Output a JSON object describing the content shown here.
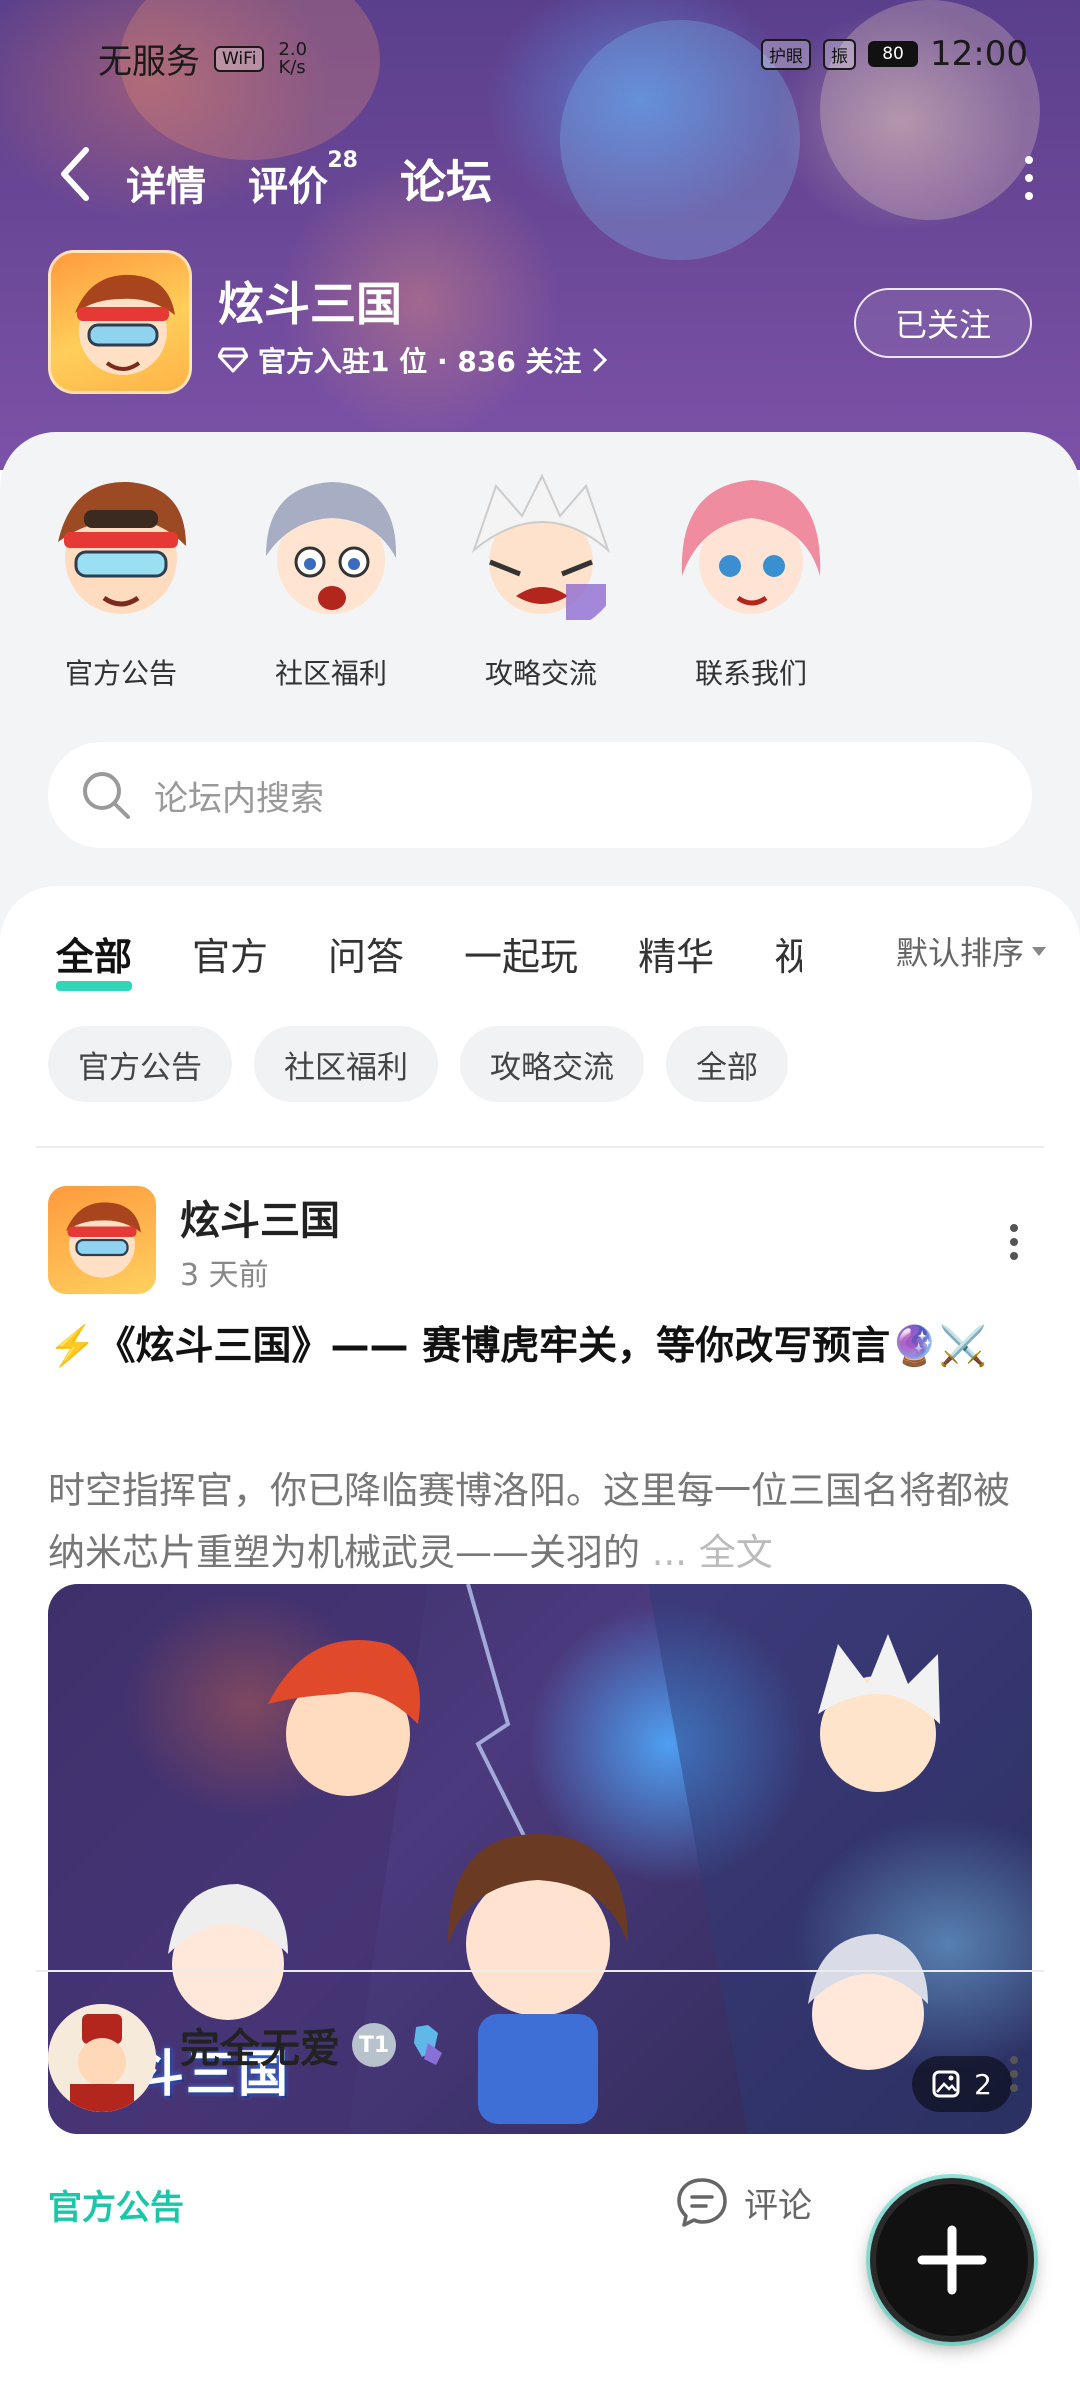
{
  "status_bar": {
    "carrier": "无服务",
    "wifi": "WiFi",
    "net_speed": "2.0 K/s",
    "eye_care": "护眼",
    "vibrate": "振",
    "battery": "80",
    "time": "12:00"
  },
  "nav": {
    "tabs": [
      {
        "label": "详情"
      },
      {
        "label": "评价",
        "badge": "28"
      },
      {
        "label": "论坛",
        "active": true
      }
    ]
  },
  "game": {
    "name": "炫斗三国",
    "meta": "官方入驻1 位 · 836 关注",
    "follow_label": "已关注"
  },
  "shortcuts": [
    {
      "label": "官方公告"
    },
    {
      "label": "社区福利"
    },
    {
      "label": "攻略交流"
    },
    {
      "label": "联系我们"
    }
  ],
  "search": {
    "placeholder": "论坛内搜索"
  },
  "feed_tabs": [
    {
      "label": "全部",
      "active": true
    },
    {
      "label": "官方"
    },
    {
      "label": "问答"
    },
    {
      "label": "一起玩"
    },
    {
      "label": "精华"
    },
    {
      "label": "视频"
    }
  ],
  "sort_label": "默认排序",
  "chips": [
    "官方公告",
    "社区福利",
    "攻略交流",
    "全部"
  ],
  "post": {
    "author": "炫斗三国",
    "time": "3 天前",
    "title": "⚡️《炫斗三国》—— 赛博虎牢关，等你改写预言🔮⚔️",
    "body": "时空指挥官，你已降临赛博洛阳。这里每一位三国名将都被纳米芯片重塑为机械武灵——关羽的",
    "ellipsis": " ... ",
    "full_text_label": "全文",
    "image_logo": "炫斗三国",
    "image_count": "2",
    "category": "官方公告",
    "comment_label": "评论"
  },
  "post2": {
    "author": "完全无爱",
    "level": "T1"
  },
  "colors": {
    "accent": "#2fd6b8",
    "category_text": "#1bc7a8",
    "header_bg": "#5a3f8c"
  }
}
